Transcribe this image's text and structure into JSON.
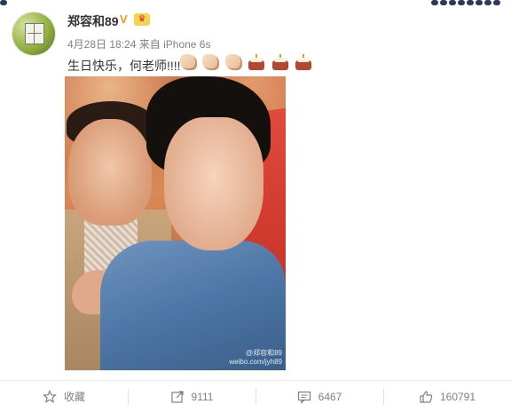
{
  "post": {
    "username": "郑容和89",
    "meta_time": "4月28日 18:24",
    "meta_source_prefix": "来自",
    "meta_source": "iPhone 6s",
    "text": "生日快乐，何老师!!!!",
    "emojis": [
      "clap-emoji",
      "clap-emoji",
      "clap-emoji",
      "cake-emoji",
      "cake-emoji",
      "cake-emoji"
    ],
    "watermark_line1": "@郑容和89",
    "watermark_line2": "weibo.com/jyh89"
  },
  "actions": {
    "favorite_label": "收藏",
    "repost_count": "9111",
    "comment_count": "6467",
    "like_count": "160791"
  },
  "colors": {
    "verify": "#f39a0b",
    "text_primary": "#333333",
    "text_muted": "#808080",
    "divider": "#e6e6e6"
  }
}
